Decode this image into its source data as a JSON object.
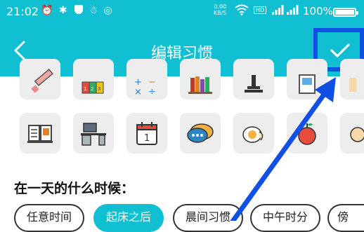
{
  "status_bar": {
    "time": "21:02",
    "network_speed_value": "0.00",
    "network_speed_unit": "KB/S",
    "hd_label": "HD",
    "signal_label_1": "4G",
    "signal_label_2": "4G",
    "battery_percent": "100%"
  },
  "app_bar": {
    "title": "编辑习惯",
    "back_icon": "chevron-left-icon",
    "confirm_icon": "checkmark-icon"
  },
  "icon_grid": {
    "row1": [
      "pencil-icon",
      "books-icon",
      "math-symbols-icon",
      "bookshelf-icon",
      "chess-piece-icon",
      "document-icon",
      "partial-icon"
    ],
    "row2": [
      "open-book-icon",
      "desk-icon",
      "calendar-icon",
      "chat-bubble-icon",
      "egg-icon",
      "apple-icon",
      "partial-icon"
    ],
    "calendar_day": "1",
    "math_symbols": "+ -\n× ÷"
  },
  "time_section": {
    "question": "在一天的什么时候：",
    "options": [
      {
        "label": "任意时间",
        "selected": false
      },
      {
        "label": "起床之后",
        "selected": true
      },
      {
        "label": "晨间习惯",
        "selected": false
      },
      {
        "label": "中午时分",
        "selected": false
      },
      {
        "label": "傍",
        "selected": false
      }
    ]
  },
  "colors": {
    "primary": "#11bfd3",
    "highlight_box": "#0f4fe3",
    "tile_background": "#ededed"
  }
}
